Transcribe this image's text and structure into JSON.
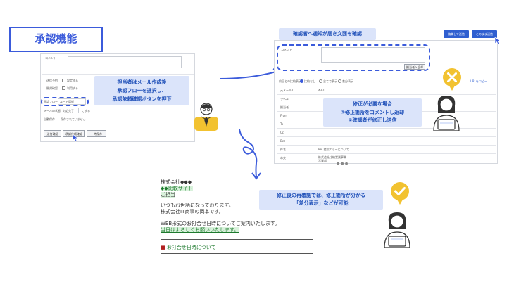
{
  "title": "承認機能",
  "left_form": {
    "comment_label": "コメント",
    "row_send": "送信予約",
    "row_send_value": "設定する",
    "row_open": "開封確認",
    "row_open_value": "利用する",
    "flow_label": "承認フロー",
    "flow_value": "ルート選択",
    "reply_label": "メールの状態を",
    "reply_value": "対応完了",
    "reply_suffix": "にする",
    "auto_label": "自動保存",
    "auto_value": "保存されていません",
    "btn_send": "送信確認",
    "btn_approval": "承認依頼確認",
    "btn_save": "一時保存"
  },
  "callouts": {
    "top": "確認者へ通知が届き文面を確認",
    "staff": [
      "担当者はメール作成後",
      "承認フローを選択し、",
      "承認依頼確認ボタンを押下"
    ],
    "fix": [
      "修正が必要な場合",
      "①修正箇所をコメントし返却",
      "②確認者が修正し送信"
    ],
    "diff": [
      "修正後の再確認では、修正箇所が分かる",
      "「差分表示」などが可能"
    ]
  },
  "right_panel": {
    "btn_edit": "編集して送信",
    "btn_send": "このまま送信",
    "comment_label": "コメント",
    "return_btn": "担当者へ返却",
    "toolbar_label": "前回との比較表示",
    "opt_compare": "比較なし",
    "opt_all": "全てで表示",
    "opt_diff": "差分表示",
    "copy_link": "URLをコピー",
    "rows": [
      {
        "label": "元メールID",
        "value": "43-1"
      },
      {
        "label": "ラベル",
        "value": ""
      },
      {
        "label": "担当者",
        "value": ""
      },
      {
        "label": "From",
        "value": ""
      },
      {
        "label": "To",
        "value": ""
      },
      {
        "label": "Cc",
        "value": ""
      },
      {
        "label": "Bcc",
        "value": ""
      },
      {
        "label": "件名",
        "value": "Re: 提案エラーについて"
      },
      {
        "label": "本文",
        "value": "株式会社比較営業事業"
      }
    ],
    "body_line2": "営業部"
  },
  "email": {
    "line1": "株式会社◆◆◆",
    "line2": "◆◆比較サイト",
    "line3": "ご担当",
    "line4": "いつもお世話になっております。",
    "line5": "株式会社IT商事の岡本です。",
    "line6": "WEB形式のお打合せ日時についてご案内いたします。",
    "line7": "当日はよろしくお願いいたします。",
    "line8_mark": "■",
    "line8": "お打合せ日時について"
  },
  "colors": {
    "accent": "#3b5bdb",
    "callout_bg": "#dbe4fa",
    "callout_text": "#1e4fb8",
    "reject": "#f2c230",
    "approve": "#f2c230"
  }
}
